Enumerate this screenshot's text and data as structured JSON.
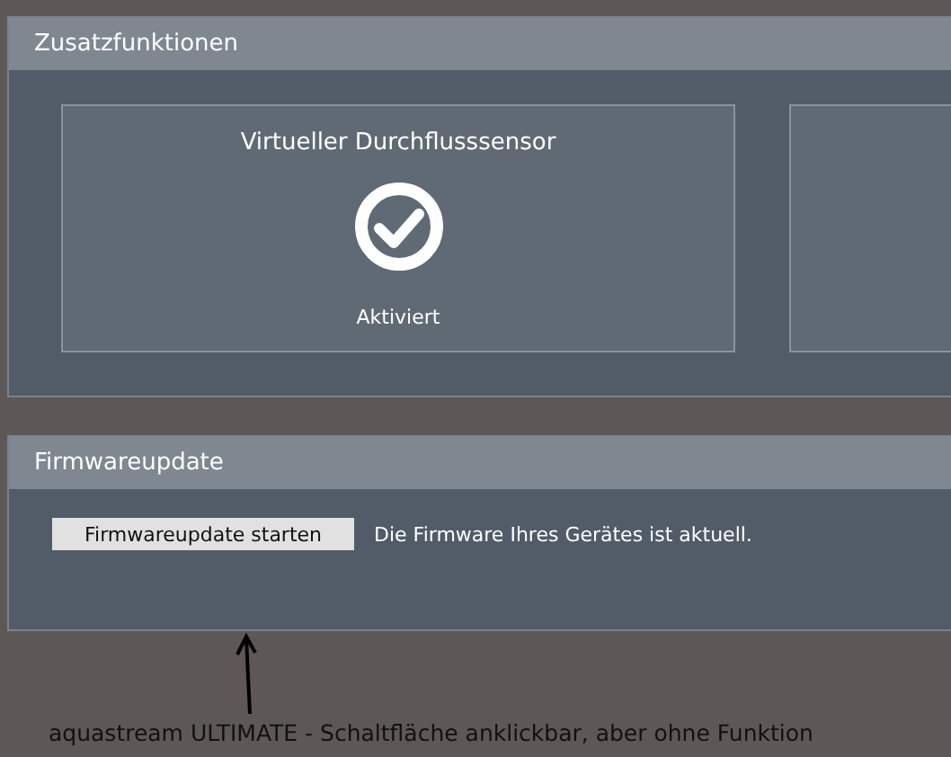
{
  "additional_functions": {
    "title": "Zusatzfunktionen",
    "features": [
      {
        "title": "Virtueller Durchflusssensor",
        "activated": true,
        "status": "Aktiviert"
      }
    ]
  },
  "firmware_update": {
    "title": "Firmwareupdate",
    "button": "Firmwareupdate starten",
    "message": "Die Firmware Ihres Gerätes ist aktuell."
  },
  "annotation": {
    "caption": "aquastream ULTIMATE - Schaltfläche anklickbar, aber ohne Funktion"
  }
}
